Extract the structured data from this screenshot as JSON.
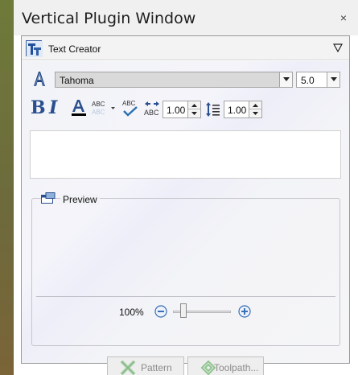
{
  "window": {
    "title": "Vertical Plugin Window",
    "close_glyph": "×"
  },
  "panel": {
    "title": "Text Creator",
    "collapse_icon": "triangle-down-icon"
  },
  "font": {
    "name": "Tahoma",
    "size": "5.0"
  },
  "toolbar": {
    "bold_label": "B",
    "italic_label": "I",
    "color_label": "A",
    "char_spacing": "1.00",
    "line_spacing": "1.00"
  },
  "text_input": {
    "value": ""
  },
  "preview": {
    "label": "Preview",
    "zoom": "100%"
  },
  "buttons": {
    "pattern_label": "Pattern",
    "toolpath_label": "Toolpath..."
  },
  "colors": {
    "accent": "#2a4f8f",
    "text_color_underline": "#000000",
    "side_strip": "#6e7a3a"
  }
}
